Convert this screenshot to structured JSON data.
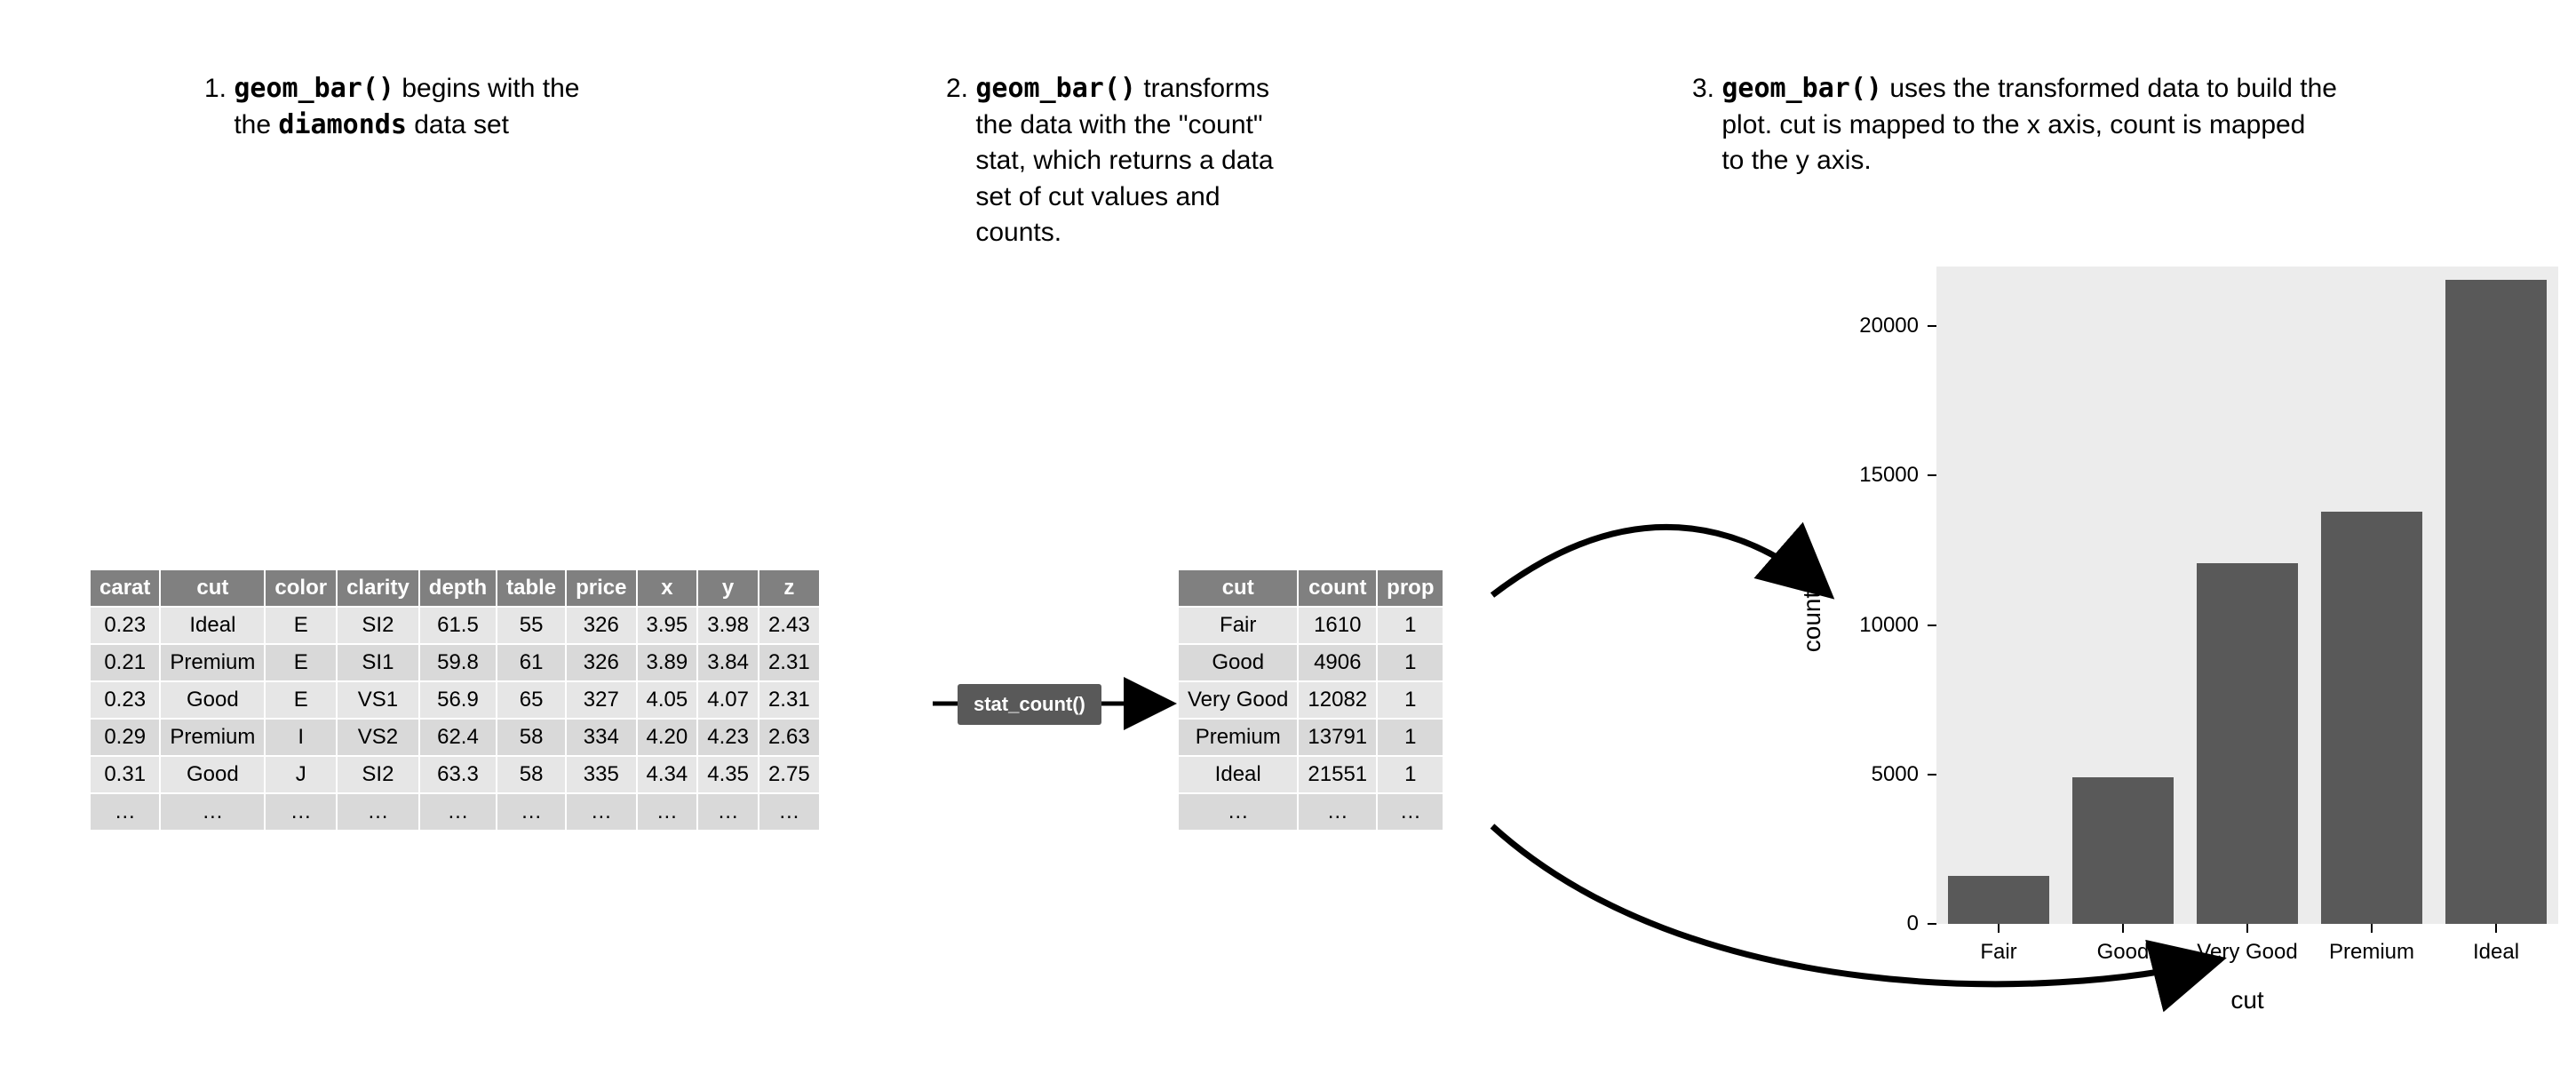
{
  "captions": {
    "one_num": "1. ",
    "one_pre": "geom_bar()",
    "one_mid": " begins with the ",
    "one_mono2": "diamonds",
    "one_post": " data set",
    "two_num": "2. ",
    "two_pre": "geom_bar()",
    "two_rest": " transforms the data with the \"count\" stat, which returns a data set of cut values and counts.",
    "three_num": "3. ",
    "three_pre": "geom_bar()",
    "three_rest": " uses the transformed data to build the plot. cut is mapped to the x axis, count is mapped to the y axis."
  },
  "pill": "stat_count()",
  "diamonds": {
    "headers": [
      "carat",
      "cut",
      "color",
      "clarity",
      "depth",
      "table",
      "price",
      "x",
      "y",
      "z"
    ],
    "rows": [
      [
        "0.23",
        "Ideal",
        "E",
        "SI2",
        "61.5",
        "55",
        "326",
        "3.95",
        "3.98",
        "2.43"
      ],
      [
        "0.21",
        "Premium",
        "E",
        "SI1",
        "59.8",
        "61",
        "326",
        "3.89",
        "3.84",
        "2.31"
      ],
      [
        "0.23",
        "Good",
        "E",
        "VS1",
        "56.9",
        "65",
        "327",
        "4.05",
        "4.07",
        "2.31"
      ],
      [
        "0.29",
        "Premium",
        "I",
        "VS2",
        "62.4",
        "58",
        "334",
        "4.20",
        "4.23",
        "2.63"
      ],
      [
        "0.31",
        "Good",
        "J",
        "SI2",
        "63.3",
        "58",
        "335",
        "4.34",
        "4.35",
        "2.75"
      ],
      [
        "…",
        "…",
        "…",
        "…",
        "…",
        "…",
        "…",
        "…",
        "…",
        "…"
      ]
    ]
  },
  "counts": {
    "headers": [
      "cut",
      "count",
      "prop"
    ],
    "rows": [
      [
        "Fair",
        "1610",
        "1"
      ],
      [
        "Good",
        "4906",
        "1"
      ],
      [
        "Very Good",
        "12082",
        "1"
      ],
      [
        "Premium",
        "13791",
        "1"
      ],
      [
        "Ideal",
        "21551",
        "1"
      ],
      [
        "…",
        "…",
        "…"
      ]
    ]
  },
  "chart_data": {
    "type": "bar",
    "categories": [
      "Fair",
      "Good",
      "Very Good",
      "Premium",
      "Ideal"
    ],
    "values": [
      1610,
      4906,
      12082,
      13791,
      21551
    ],
    "title": "",
    "xlabel": "cut",
    "ylabel": "count",
    "ylim": [
      0,
      22000
    ],
    "yticks": [
      0,
      5000,
      10000,
      15000,
      20000
    ]
  }
}
